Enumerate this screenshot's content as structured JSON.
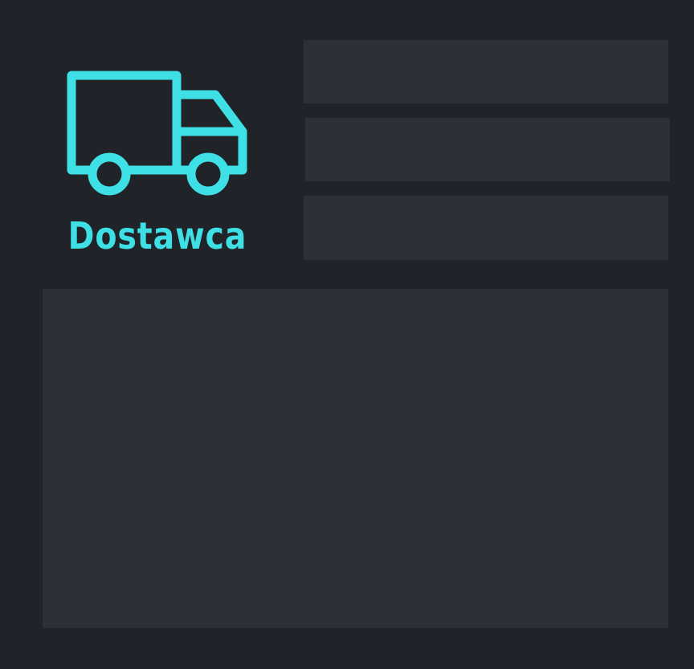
{
  "logo": {
    "label": "Dostawca",
    "icon": "truck-icon",
    "accent_color": "#3ee0e6"
  },
  "colors": {
    "background": "#202327",
    "panel": "#2d3035"
  },
  "fields": [
    {
      "value": ""
    },
    {
      "value": ""
    },
    {
      "value": ""
    }
  ],
  "details": {
    "content": ""
  }
}
